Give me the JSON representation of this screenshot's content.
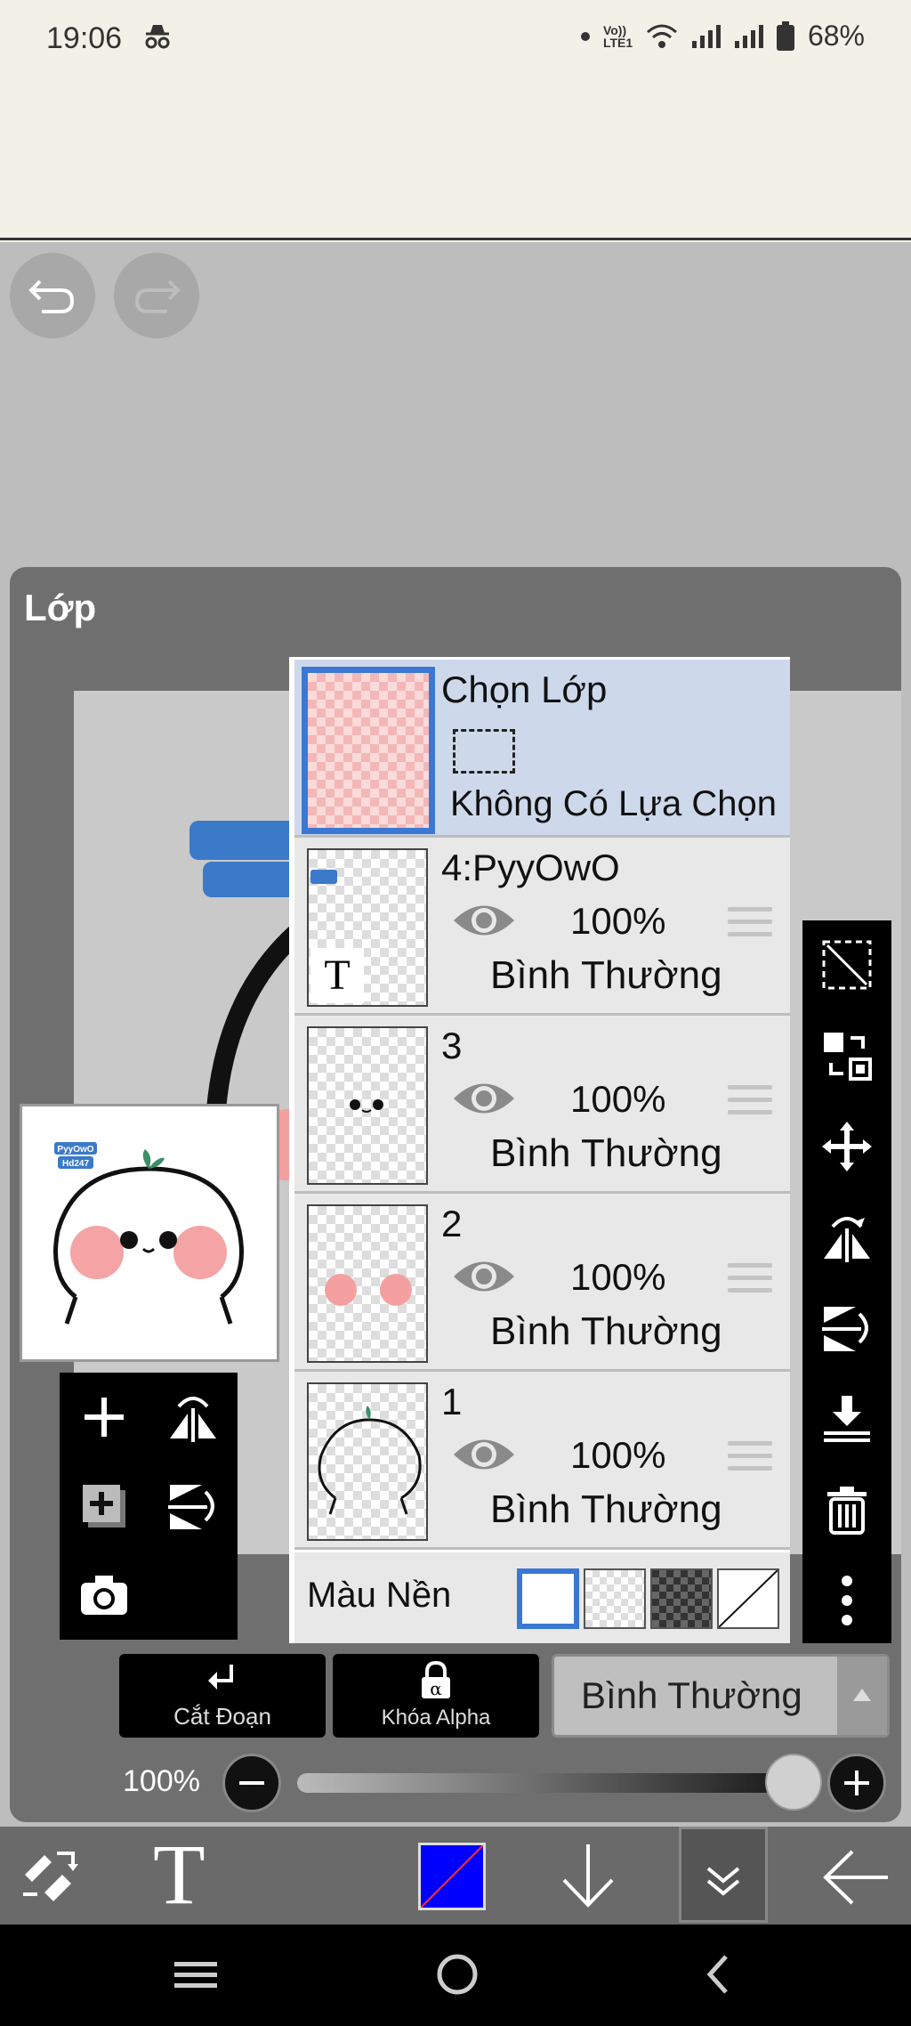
{
  "status_bar": {
    "time": "19:06",
    "battery": "68%",
    "volte": "Vo)) LTE1"
  },
  "panel": {
    "title": "Lớp"
  },
  "layers": [
    {
      "name": "Chọn Lớp",
      "selection_text": "Không Có Lựa Chọn",
      "selected": true
    },
    {
      "name": "4:PyyOwO",
      "opacity": "100%",
      "mode": "Bình Thường"
    },
    {
      "name": "3",
      "opacity": "100%",
      "mode": "Bình Thường"
    },
    {
      "name": "2",
      "opacity": "100%",
      "mode": "Bình Thường"
    },
    {
      "name": "1",
      "opacity": "100%",
      "mode": "Bình Thường"
    }
  ],
  "background_row": {
    "label": "Màu Nền"
  },
  "preview": {
    "watermark_line1": "PyyOwO",
    "watermark_line2": "Hd247"
  },
  "bottom": {
    "clip_label": "Cắt Đoạn",
    "alpha_lock_label": "Khóa Alpha",
    "blend_mode": "Bình Thường",
    "opacity": "100%"
  },
  "thumb_text_icon": "T",
  "toolbar": {
    "text_tool": "T",
    "current_color": "#0000ff"
  }
}
